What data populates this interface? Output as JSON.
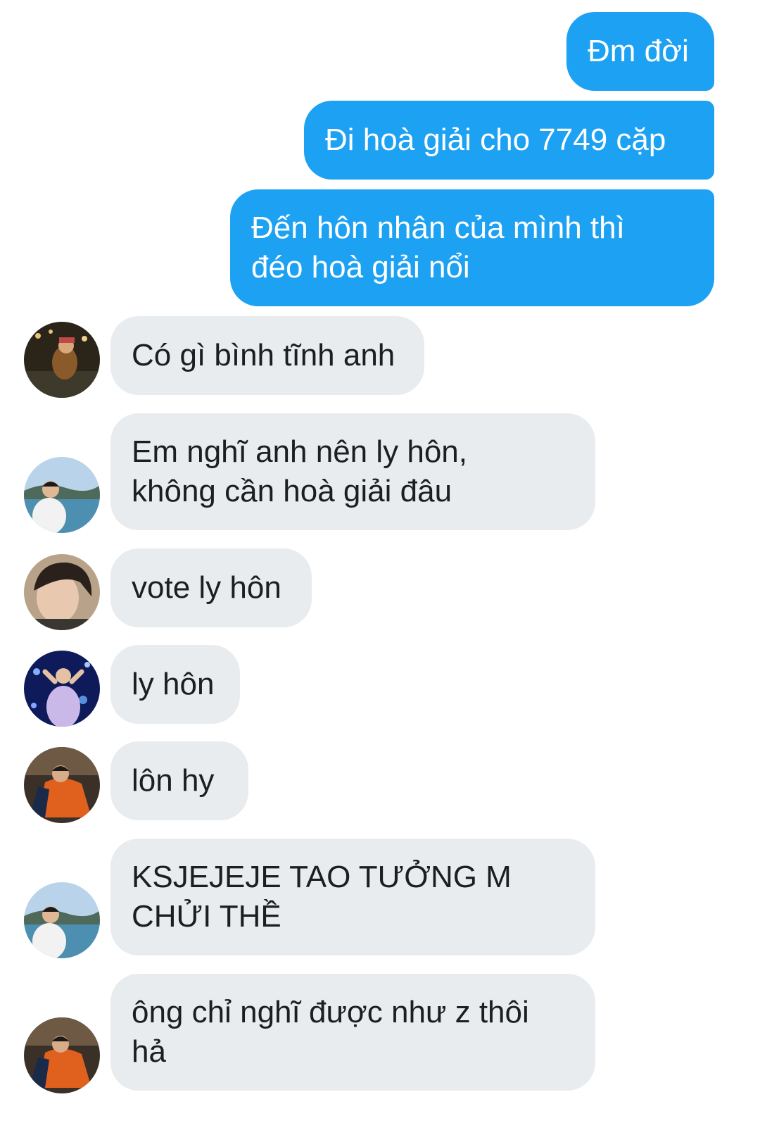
{
  "messages": {
    "outgoing": [
      {
        "text": "Đm đời"
      },
      {
        "text": "Đi hoà giải cho 7749 cặp"
      },
      {
        "text": "Đến hôn nhân của mình thì\nđéo hoà giải nổi"
      }
    ],
    "incoming": [
      {
        "text": "Có gì bình tĩnh anh",
        "avatar_icon": "night-photo-avatar-icon"
      },
      {
        "text": "Em nghĩ anh nên ly hôn,\nkhông cần hoà giải đâu",
        "avatar_icon": "sea-view-avatar-icon"
      },
      {
        "text": "vote ly hôn",
        "avatar_icon": "portrait-avatar-icon"
      },
      {
        "text": "ly hôn",
        "avatar_icon": "blue-lights-avatar-icon"
      },
      {
        "text": "lôn hy",
        "avatar_icon": "orange-shirt-avatar-icon"
      },
      {
        "text": "KSJEJEJE TAO TƯỞNG M\nCHỬI THỀ",
        "avatar_icon": "sea-view-avatar-icon"
      },
      {
        "text": "ông chỉ nghĩ được như z thôi\nhả",
        "avatar_icon": "orange-shirt-avatar-icon"
      }
    ]
  },
  "colors": {
    "outgoing_bubble": "#1da1f2",
    "incoming_bubble": "#e9ecef"
  }
}
